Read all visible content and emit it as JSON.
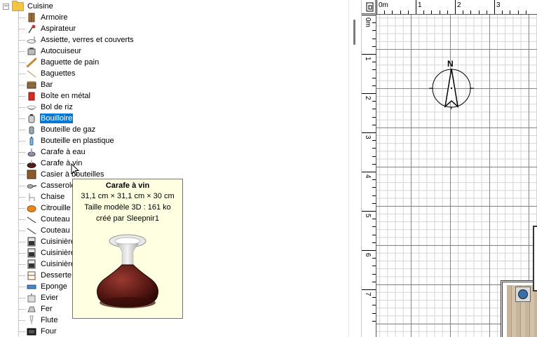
{
  "tree": {
    "root_label": "Cuisine",
    "root_expander": "−",
    "items": [
      {
        "label": "Armoire",
        "icon": "cabinet-icon"
      },
      {
        "label": "Aspirateur",
        "icon": "vacuum-icon"
      },
      {
        "label": "Assiette, verres et couverts",
        "icon": "tableware-icon"
      },
      {
        "label": "Autocuiseur",
        "icon": "pressure-cooker-icon"
      },
      {
        "label": "Baguette de pain",
        "icon": "bread-icon"
      },
      {
        "label": "Baguettes",
        "icon": "chopsticks-icon"
      },
      {
        "label": "Bar",
        "icon": "bar-icon"
      },
      {
        "label": "Boîte en métal",
        "icon": "tin-box-icon"
      },
      {
        "label": "Bol de riz",
        "icon": "rice-bowl-icon"
      },
      {
        "label": "Bouilloire",
        "icon": "kettle-icon",
        "selected": true
      },
      {
        "label": "Bouteille de gaz",
        "icon": "gas-bottle-icon"
      },
      {
        "label": "Bouteille en plastique",
        "icon": "plastic-bottle-icon"
      },
      {
        "label": "Carafe à eau",
        "icon": "water-carafe-icon"
      },
      {
        "label": "Carafe à vin",
        "icon": "wine-carafe-icon"
      },
      {
        "label": "Casier à bouteilles",
        "icon": "bottle-rack-icon"
      },
      {
        "label": "Casserole",
        "icon": "saucepan-icon"
      },
      {
        "label": "Chaise",
        "icon": "chair-icon"
      },
      {
        "label": "Citrouille",
        "icon": "pumpkin-icon"
      },
      {
        "label": "Couteau",
        "icon": "knife-icon"
      },
      {
        "label": "Couteau",
        "icon": "knife-icon"
      },
      {
        "label": "Cuisinière",
        "icon": "stove-icon"
      },
      {
        "label": "Cuisinière",
        "icon": "stove-icon"
      },
      {
        "label": "Cuisinière",
        "icon": "stove-icon"
      },
      {
        "label": "Desserte",
        "icon": "trolley-icon"
      },
      {
        "label": "Eponge",
        "icon": "sponge-icon"
      },
      {
        "label": "Evier",
        "icon": "sink-icon"
      },
      {
        "label": "Fer",
        "icon": "iron-icon"
      },
      {
        "label": "Flute",
        "icon": "flute-glass-icon"
      },
      {
        "label": "Four",
        "icon": "oven-icon"
      }
    ]
  },
  "tooltip": {
    "title": "Carafe à vin",
    "dimensions": "31,1 cm × 31,1 cm × 30 cm",
    "model_size": "Taille modèle 3D : 161 ko",
    "author": "créé par Sleepnir1"
  },
  "plan": {
    "h_ruler_labels": [
      "0m",
      "1",
      "2",
      "3"
    ],
    "v_ruler_labels": [
      "0m",
      "1",
      "2",
      "3",
      "4",
      "5",
      "6",
      "7"
    ],
    "compass_label": "N"
  }
}
